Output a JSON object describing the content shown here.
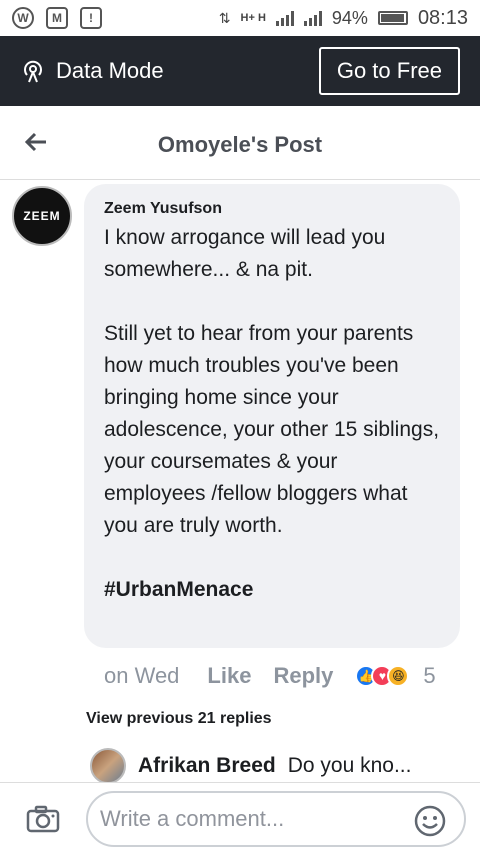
{
  "status_bar": {
    "icons": [
      "wordpress-icon",
      "gmail-icon",
      "notification-icon"
    ],
    "network": "H+ H",
    "battery_percent": "94%",
    "time": "08:13"
  },
  "data_mode": {
    "label": "Data Mode",
    "go_free_label": "Go to Free"
  },
  "header": {
    "title": "Omoyele's Post"
  },
  "comment": {
    "avatar_text": "ZEEM",
    "author": "Zeem Yusufson",
    "paragraphs": [
      "I know arrogance will lead you somewhere... & na pit.",
      "Still yet to hear from your parents how much troubles you've been bringing home since your adolescence, your other 15 siblings, your coursemates & your employees /fellow bloggers what you are truly worth."
    ],
    "hashtag": "#UrbanMenace",
    "time": "on Wed",
    "like_label": "Like",
    "reply_label": "Reply",
    "reaction_count": "5"
  },
  "replies": {
    "view_previous_label": "View previous 21 replies",
    "latest": {
      "author": "Afrikan Breed",
      "text": "Do you kno..."
    }
  },
  "composer": {
    "placeholder": "Write a comment..."
  },
  "colors": {
    "data_bar_bg": "#23272e",
    "bubble_bg": "#f0f1f4",
    "like_blue": "#1877f2",
    "love_red": "#f33e58",
    "haha_yellow": "#f7b125"
  }
}
